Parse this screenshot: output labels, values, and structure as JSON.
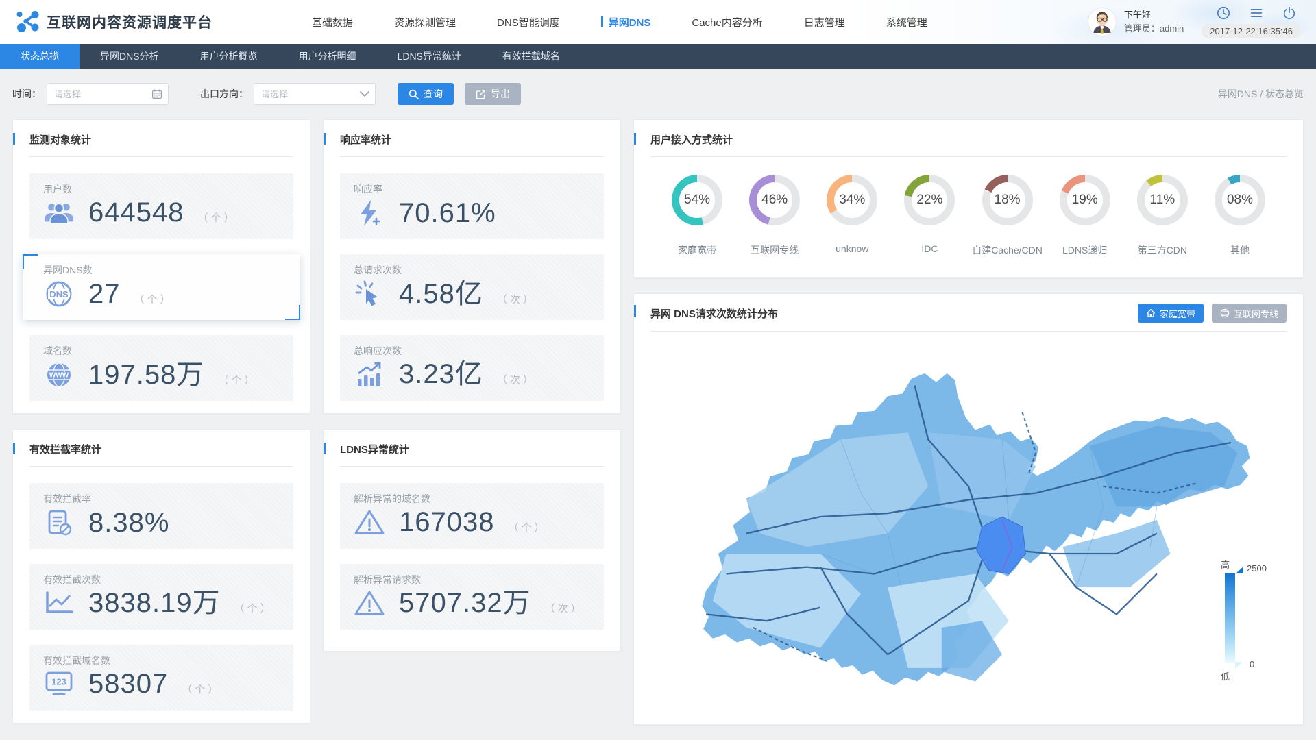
{
  "header": {
    "app_title": "互联网内容资源调度平台",
    "nav": [
      {
        "label": "基础数据",
        "active": false
      },
      {
        "label": "资源探测管理",
        "active": false
      },
      {
        "label": "DNS智能调度",
        "active": false
      },
      {
        "label": "异网DNS",
        "active": true
      },
      {
        "label": "Cache内容分析",
        "active": false
      },
      {
        "label": "日志管理",
        "active": false
      },
      {
        "label": "系统管理",
        "active": false
      }
    ],
    "greeting": "下午好",
    "admin_label": "管理员：admin",
    "datetime": "2017-12-22 16:35:46"
  },
  "subnav": {
    "tabs": [
      {
        "label": "状态总揽",
        "active": true
      },
      {
        "label": "异网DNS分析",
        "active": false
      },
      {
        "label": "用户分析概览",
        "active": false
      },
      {
        "label": "用户分析明细",
        "active": false
      },
      {
        "label": "LDNS异常统计",
        "active": false
      },
      {
        "label": "有效拦截域名",
        "active": false
      }
    ]
  },
  "filters": {
    "time_label": "时间：",
    "time_placeholder": "请选择",
    "direction_label": "出口方向：",
    "direction_placeholder": "请选择",
    "query_button": "查询",
    "export_button": "导出",
    "breadcrumb": "异网DNS / 状态总览"
  },
  "cards": {
    "monitor": {
      "title": "监测对象统计",
      "stats": [
        {
          "label": "用户数",
          "value": "644548",
          "unit": "（个）"
        },
        {
          "label": "异网DNS数",
          "value": "27",
          "unit": "（个）"
        },
        {
          "label": "域名数",
          "value": "197.58万",
          "unit": "（个）"
        }
      ]
    },
    "response": {
      "title": "响应率统计",
      "stats": [
        {
          "label": "响应率",
          "value": "70.61%",
          "unit": ""
        },
        {
          "label": "总请求次数",
          "value": "4.58亿",
          "unit": "（次）"
        },
        {
          "label": "总响应次数",
          "value": "3.23亿",
          "unit": "（次）"
        }
      ]
    },
    "intercept": {
      "title": "有效拦截率统计",
      "stats": [
        {
          "label": "有效拦截率",
          "value": "8.38%",
          "unit": ""
        },
        {
          "label": "有效拦截次数",
          "value": "3838.19万",
          "unit": "（个）"
        },
        {
          "label": "有效拦截域名数",
          "value": "58307",
          "unit": "（个）"
        }
      ]
    },
    "ldns": {
      "title": "LDNS异常统计",
      "stats": [
        {
          "label": "解析异常的域名数",
          "value": "167038",
          "unit": "（个）"
        },
        {
          "label": "解析异常请求数",
          "value": "5707.32万",
          "unit": "（次）"
        }
      ]
    },
    "access": {
      "title": "用户接入方式统计",
      "donuts": [
        {
          "label": "家庭宽带",
          "pct": 54,
          "display": "54%",
          "color": "#35c4c0"
        },
        {
          "label": "互联网专线",
          "pct": 46,
          "display": "46%",
          "color": "#a78ed6"
        },
        {
          "label": "unknow",
          "pct": 34,
          "display": "34%",
          "color": "#f9b37d"
        },
        {
          "label": "IDC",
          "pct": 22,
          "display": "22%",
          "color": "#82a43a"
        },
        {
          "label": "自建Cache/CDN",
          "pct": 18,
          "display": "18%",
          "color": "#95615d"
        },
        {
          "label": "LDNS递归",
          "pct": 19,
          "display": "19%",
          "color": "#e9947d"
        },
        {
          "label": "第三方CDN",
          "pct": 11,
          "display": "11%",
          "color": "#bfc23a"
        },
        {
          "label": "其他",
          "pct": 8,
          "display": "08%",
          "color": "#39a5c4"
        }
      ]
    },
    "map": {
      "title": "异网 DNS请求次数统计分布",
      "buttons": [
        {
          "label": "家庭宽带",
          "active": true
        },
        {
          "label": "互联网专线",
          "active": false
        }
      ],
      "legend": {
        "high": "高",
        "low": "低",
        "max": "2500",
        "min": "0"
      }
    }
  },
  "chart_data": [
    {
      "type": "pie",
      "title": "用户接入方式统计",
      "categories": [
        "家庭宽带",
        "互联网专线",
        "unknow",
        "IDC",
        "自建Cache/CDN",
        "LDNS递归",
        "第三方CDN",
        "其他"
      ],
      "values": [
        54,
        46,
        34,
        22,
        18,
        19,
        11,
        8
      ],
      "unit": "%",
      "legend_position": "below-each-ring"
    },
    {
      "type": "heatmap",
      "title": "异网 DNS请求次数统计分布",
      "region": "山东省",
      "value_range": [
        0,
        2500
      ],
      "scale_labels": [
        "低",
        "高"
      ]
    }
  ]
}
